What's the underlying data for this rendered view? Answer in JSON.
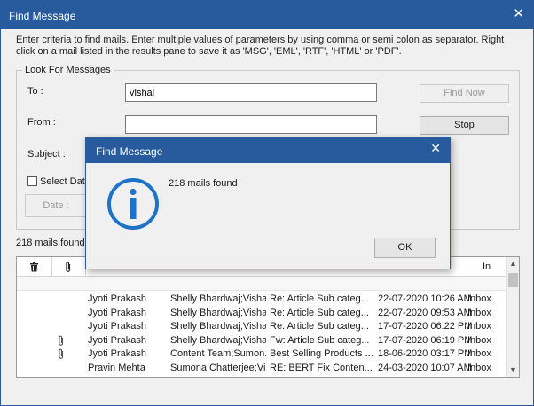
{
  "window": {
    "title": "Find Message",
    "close_glyph": "✕"
  },
  "description": "Enter criteria to find mails. Enter multiple values of parameters by using comma or semi colon as separator. Right click on a mail listed in the results pane to save it as 'MSG', 'EML', 'RTF', 'HTML' or 'PDF'.",
  "look_for": {
    "legend": "Look For Messages",
    "to_label": "To :",
    "to_value": "vishal",
    "from_label": "From :",
    "from_value": "",
    "subject_label": "Subject :",
    "select_date_label": "Select Date",
    "date_button": "Date :",
    "find_now_button": "Find Now",
    "stop_button": "Stop"
  },
  "results": {
    "count_text": "218 mails found",
    "columns": {
      "delete_icon": "trash-icon",
      "attach_icon": "paperclip-icon",
      "folder": "In Folder"
    },
    "rows": [
      {
        "attachment": false,
        "from": "Jyoti Prakash",
        "to": "Shelly Bhardwaj;Visha...",
        "subject": "Re: Article Sub categ...",
        "date": "22-07-2020 10:26 AM",
        "folder": "Inbox"
      },
      {
        "attachment": false,
        "from": "Jyoti Prakash",
        "to": "Shelly Bhardwaj;Visha...",
        "subject": "Re: Article Sub categ...",
        "date": "22-07-2020 09:53 AM",
        "folder": "Inbox"
      },
      {
        "attachment": false,
        "from": "Jyoti Prakash",
        "to": "Shelly Bhardwaj;Visha...",
        "subject": "Re: Article Sub categ...",
        "date": "17-07-2020 06:22 PM",
        "folder": "Inbox"
      },
      {
        "attachment": true,
        "from": "Jyoti Prakash",
        "to": "Shelly Bhardwaj;Visha...",
        "subject": "Fw: Article Sub categ...",
        "date": "17-07-2020 06:19 PM",
        "folder": "Inbox"
      },
      {
        "attachment": true,
        "from": "Jyoti Prakash",
        "to": "Content Team;Sumon...",
        "subject": "Best Selling Products ...",
        "date": "18-06-2020 03:17 PM",
        "folder": "Inbox"
      },
      {
        "attachment": false,
        "from": "Pravin Mehta",
        "to": "Sumona Chatterjee;Vi...",
        "subject": "RE: BERT Fix Conten...",
        "date": "24-03-2020 10:07 AM",
        "folder": "Inbox"
      }
    ]
  },
  "dialog": {
    "title": "Find Message",
    "close_glyph": "✕",
    "message": "218 mails found",
    "ok_button": "OK",
    "icon": "info-icon"
  },
  "colors": {
    "titlebar": "#275b9e",
    "info_icon": "#1e73c8"
  }
}
